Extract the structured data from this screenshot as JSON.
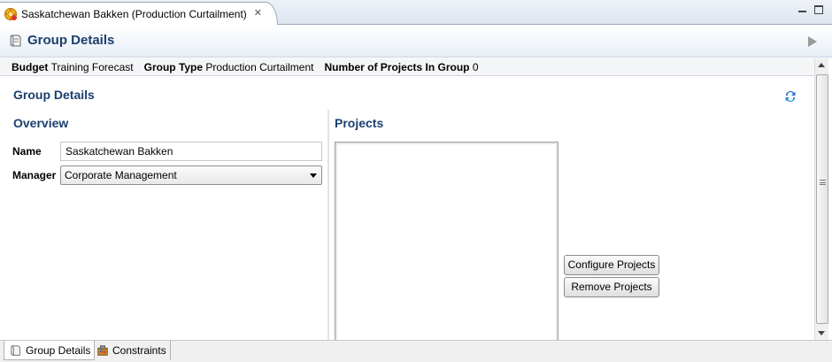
{
  "editor_tab": {
    "title": "Saskatchewan Bakken (Production Curtailment)",
    "close": "✕"
  },
  "header": {
    "title": "Group Details"
  },
  "info": {
    "budget_label": "Budget",
    "budget_value": "Training Forecast",
    "group_type_label": "Group Type",
    "group_type_value": "Production Curtailment",
    "num_projects_label": "Number of Projects In Group",
    "num_projects_value": "0"
  },
  "section": {
    "title": "Group Details"
  },
  "overview": {
    "title": "Overview",
    "name_label": "Name",
    "name_value": "Saskatchewan Bakken",
    "manager_label": "Manager",
    "manager_value": "Corporate Management"
  },
  "projects": {
    "title": "Projects",
    "configure_label": "Configure Projects",
    "remove_label": "Remove Projects"
  },
  "bottom_tabs": [
    {
      "label": "Group Details",
      "icon": "page-icon",
      "active": true
    },
    {
      "label": "Constraints",
      "icon": "constraints-icon",
      "active": false
    }
  ],
  "colors": {
    "heading": "#1a3f6e",
    "accent": "#2a6fc9"
  }
}
